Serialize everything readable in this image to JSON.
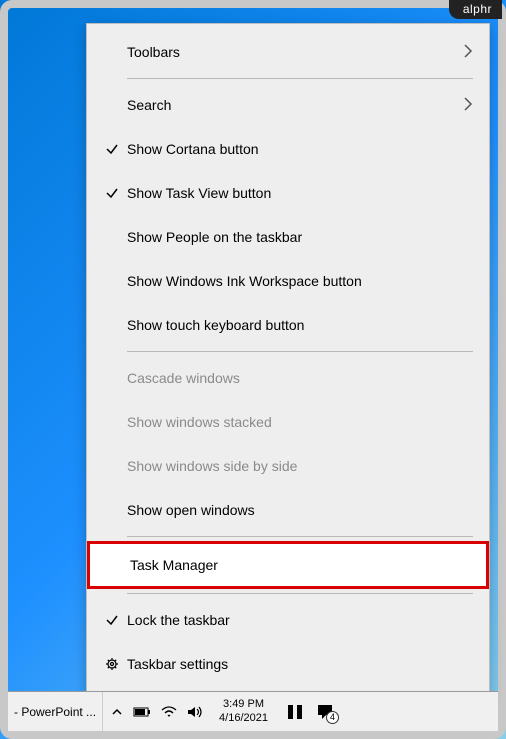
{
  "badge": "alphr",
  "menu": {
    "toolbars": "Toolbars",
    "search": "Search",
    "show_cortana": "Show Cortana button",
    "show_task_view": "Show Task View button",
    "show_people": "Show People on the taskbar",
    "show_ink": "Show Windows Ink Workspace button",
    "show_touch_kb": "Show touch keyboard button",
    "cascade": "Cascade windows",
    "stacked": "Show windows stacked",
    "side_by_side": "Show windows side by side",
    "open_windows": "Show open windows",
    "task_manager": "Task Manager",
    "lock_taskbar": "Lock the taskbar",
    "taskbar_settings": "Taskbar settings"
  },
  "taskbar": {
    "app": "- PowerPoint ...",
    "time": "3:49 PM",
    "date": "4/16/2021",
    "notif_count": "4"
  }
}
